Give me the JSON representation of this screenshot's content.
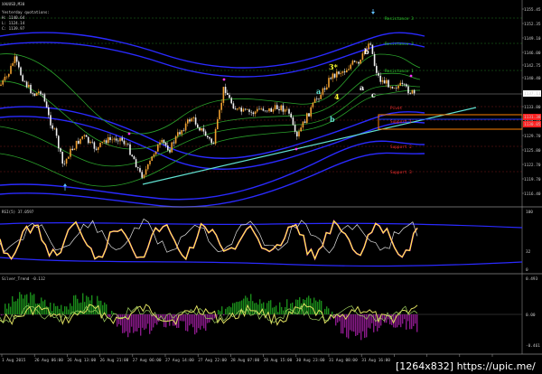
{
  "symbol_line": "XAUUSD,M30",
  "quote_lines": [
    "Yesterday quotations:",
    "H: 1140.64",
    "L: 1124.14",
    "C: 1139.97"
  ],
  "levels": {
    "r3": "Resistance 3",
    "r2": "Resistance 2",
    "r1": "Resistance 1",
    "pivot": "Pivot",
    "s1": "Support 1",
    "s2": "Support 2",
    "s3": "Support 3"
  },
  "waves": {
    "b_top": "b",
    "w3": "3*",
    "a1": "a",
    "w4": "4",
    "a2": "a",
    "c": "c",
    "b_low": "b"
  },
  "price_axis": [
    "1155.45",
    "1152.35",
    "1149.10",
    "1146.00",
    "1142.75",
    "1140.40",
    "1137.11",
    "1133.80",
    "1130.55",
    "1129.70",
    "1125.80",
    "1122.70",
    "1119.70",
    "1116.40"
  ],
  "price_labels": {
    "current": "1137.11",
    "box1": "1131.38",
    "box2": "1130.05"
  },
  "rsi": {
    "title": "RSI(5) 37.0597",
    "axis": [
      "100",
      "32",
      "0"
    ]
  },
  "silver": {
    "title": "Silver_Trend -0.112",
    "axis": [
      "0.493",
      "0.00",
      "-0.461"
    ]
  },
  "time_axis": [
    "1 Aug 2015",
    "26 Aug 06:00",
    "26 Aug 13:00",
    "26 Aug 21:00",
    "27 Aug 06:00",
    "27 Aug 14:00",
    "27 Aug 22:00",
    "28 Aug 07:00",
    "28 Aug 15:00",
    "30 Aug 23:00",
    "31 Aug 08:00",
    "31 Aug 16:00",
    "1 Sep 01:00",
    "1 Sep 09:00",
    "1 Sep 17:00",
    "2 Sep 02:00"
  ],
  "watermark": "[1264x832] https://upic.me/",
  "colors": {
    "bull": "#f0a030",
    "bear": "#f0f0f0",
    "accent_yellow": "#ffff30",
    "magenta": "#ff30ff",
    "trendline": "#60e0d0",
    "blue_band": "#2a2aff",
    "green_band": "#30c030",
    "orange_box": "#ff8000",
    "support_red": "#ff2020"
  }
}
